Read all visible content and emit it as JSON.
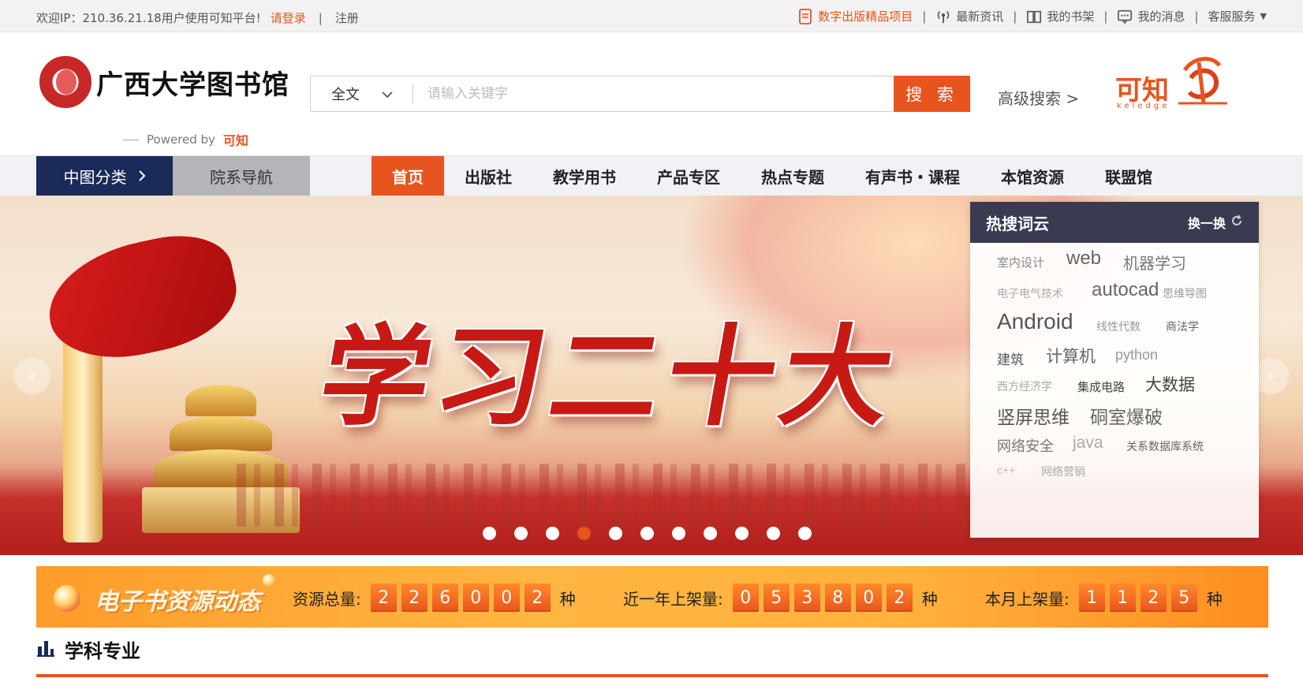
{
  "topbar": {
    "welcome": "欢迎IP：210.36.21.18用户使用可知平台!",
    "login": "请登录",
    "sep": "|",
    "register": "注册",
    "links": [
      {
        "label": "数字出版精品项目",
        "icon": "document-icon",
        "highlight": true
      },
      {
        "label": "最新资讯",
        "icon": "broadcast-icon",
        "highlight": false
      },
      {
        "label": "我的书架",
        "icon": "book-icon",
        "highlight": false
      },
      {
        "label": "我的消息",
        "icon": "message-icon",
        "highlight": false
      },
      {
        "label": "客服服务",
        "icon": "chevron-down-icon",
        "highlight": false
      }
    ]
  },
  "header": {
    "library_name": "广西大学图书馆",
    "powered_by": "Powered by",
    "powered_brand": "可知",
    "search": {
      "scope": "全文",
      "placeholder": "请输入关键字",
      "button": "搜 索"
    },
    "advanced_search": "高级搜索 >",
    "brand_logo_text": "可知",
    "brand_logo_sub": "keledge"
  },
  "nav": {
    "category": "中图分类",
    "department": "院系导航",
    "items": [
      "首页",
      "出版社",
      "教学用书",
      "产品专区",
      "热点专题",
      "有声书・课程",
      "本馆资源",
      "联盟馆"
    ],
    "active_index": 0
  },
  "banner": {
    "title": "学习二十大",
    "slide_count": 11,
    "active_slide": 4,
    "prev": "‹",
    "next": "›"
  },
  "hot_words": {
    "title": "热搜词云",
    "refresh": "换一换",
    "words": [
      {
        "text": "室内设计",
        "size": "sm"
      },
      {
        "text": "web",
        "size": "lg"
      },
      {
        "text": "机器学习",
        "size": "md"
      },
      {
        "text": "电子电气技术",
        "size": "xs"
      },
      {
        "text": "autocad",
        "size": "lg"
      },
      {
        "text": "思维导图",
        "size": "xs"
      },
      {
        "text": "Android",
        "size": "xl"
      },
      {
        "text": "线性代数",
        "size": "xs"
      },
      {
        "text": "商法学",
        "size": "xs"
      },
      {
        "text": "建筑",
        "size": "sm"
      },
      {
        "text": "计算机",
        "size": "md"
      },
      {
        "text": "python",
        "size": "sm"
      },
      {
        "text": "西方经济学",
        "size": "xs"
      },
      {
        "text": "集成电路",
        "size": "xs"
      },
      {
        "text": "大数据",
        "size": "md"
      },
      {
        "text": "竖屏思维",
        "size": "lg"
      },
      {
        "text": "硐室爆破",
        "size": "lg"
      },
      {
        "text": "网络安全",
        "size": "sm"
      },
      {
        "text": "java",
        "size": "md"
      },
      {
        "text": "关系数据库系统",
        "size": "xs"
      },
      {
        "text": "c++",
        "size": "xs"
      },
      {
        "text": "网络营销",
        "size": "xs"
      }
    ]
  },
  "stats": {
    "title": "电子书资源动态",
    "items": [
      {
        "label": "资源总量:",
        "digits": [
          "2",
          "2",
          "6",
          "0",
          "0",
          "2"
        ],
        "unit": "种"
      },
      {
        "label": "近一年上架量:",
        "digits": [
          "0",
          "5",
          "3",
          "8",
          "0",
          "2"
        ],
        "unit": "种"
      },
      {
        "label": "本月上架量:",
        "digits": [
          "1",
          "1",
          "2",
          "5"
        ],
        "unit": "种"
      }
    ]
  },
  "section": {
    "title": "学科专业"
  },
  "colors": {
    "accent": "#e8541e",
    "nav_dark": "#1a2a5a",
    "nav_gray": "#b4b5b8",
    "hot_header": "#3a3a52"
  }
}
